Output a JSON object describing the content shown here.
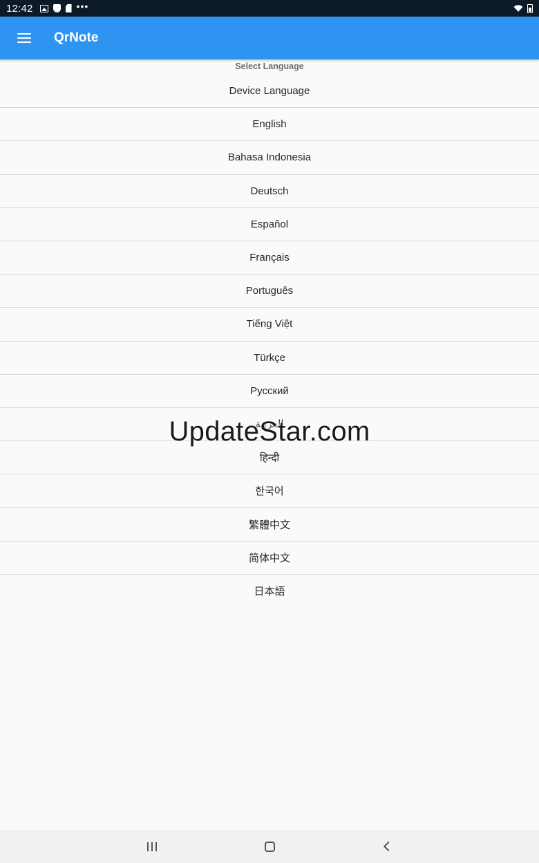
{
  "status_bar": {
    "time": "12:42",
    "icons_left": [
      "image-icon",
      "shield-icon",
      "sd-card-icon",
      "more-dots-icon"
    ],
    "icons_right": [
      "wifi-icon",
      "battery-icon"
    ],
    "dots": "•••"
  },
  "app_bar": {
    "title": "QrNote",
    "background": "#2d94f1",
    "menu_icon": "hamburger-menu-icon"
  },
  "section_header": "Select Language",
  "languages": [
    "Device Language",
    "English",
    "Bahasa Indonesia",
    "Deutsch",
    "Español",
    "Français",
    "Português",
    "Tiếng Việt",
    "Türkçe",
    "Русский",
    "العربية",
    "हिन्दी",
    "한국어",
    "繁體中文",
    "简体中文",
    "日本語"
  ],
  "watermark": "UpdateStar.com",
  "nav_bar": {
    "icons": [
      "recents-icon",
      "home-icon",
      "back-icon"
    ]
  }
}
